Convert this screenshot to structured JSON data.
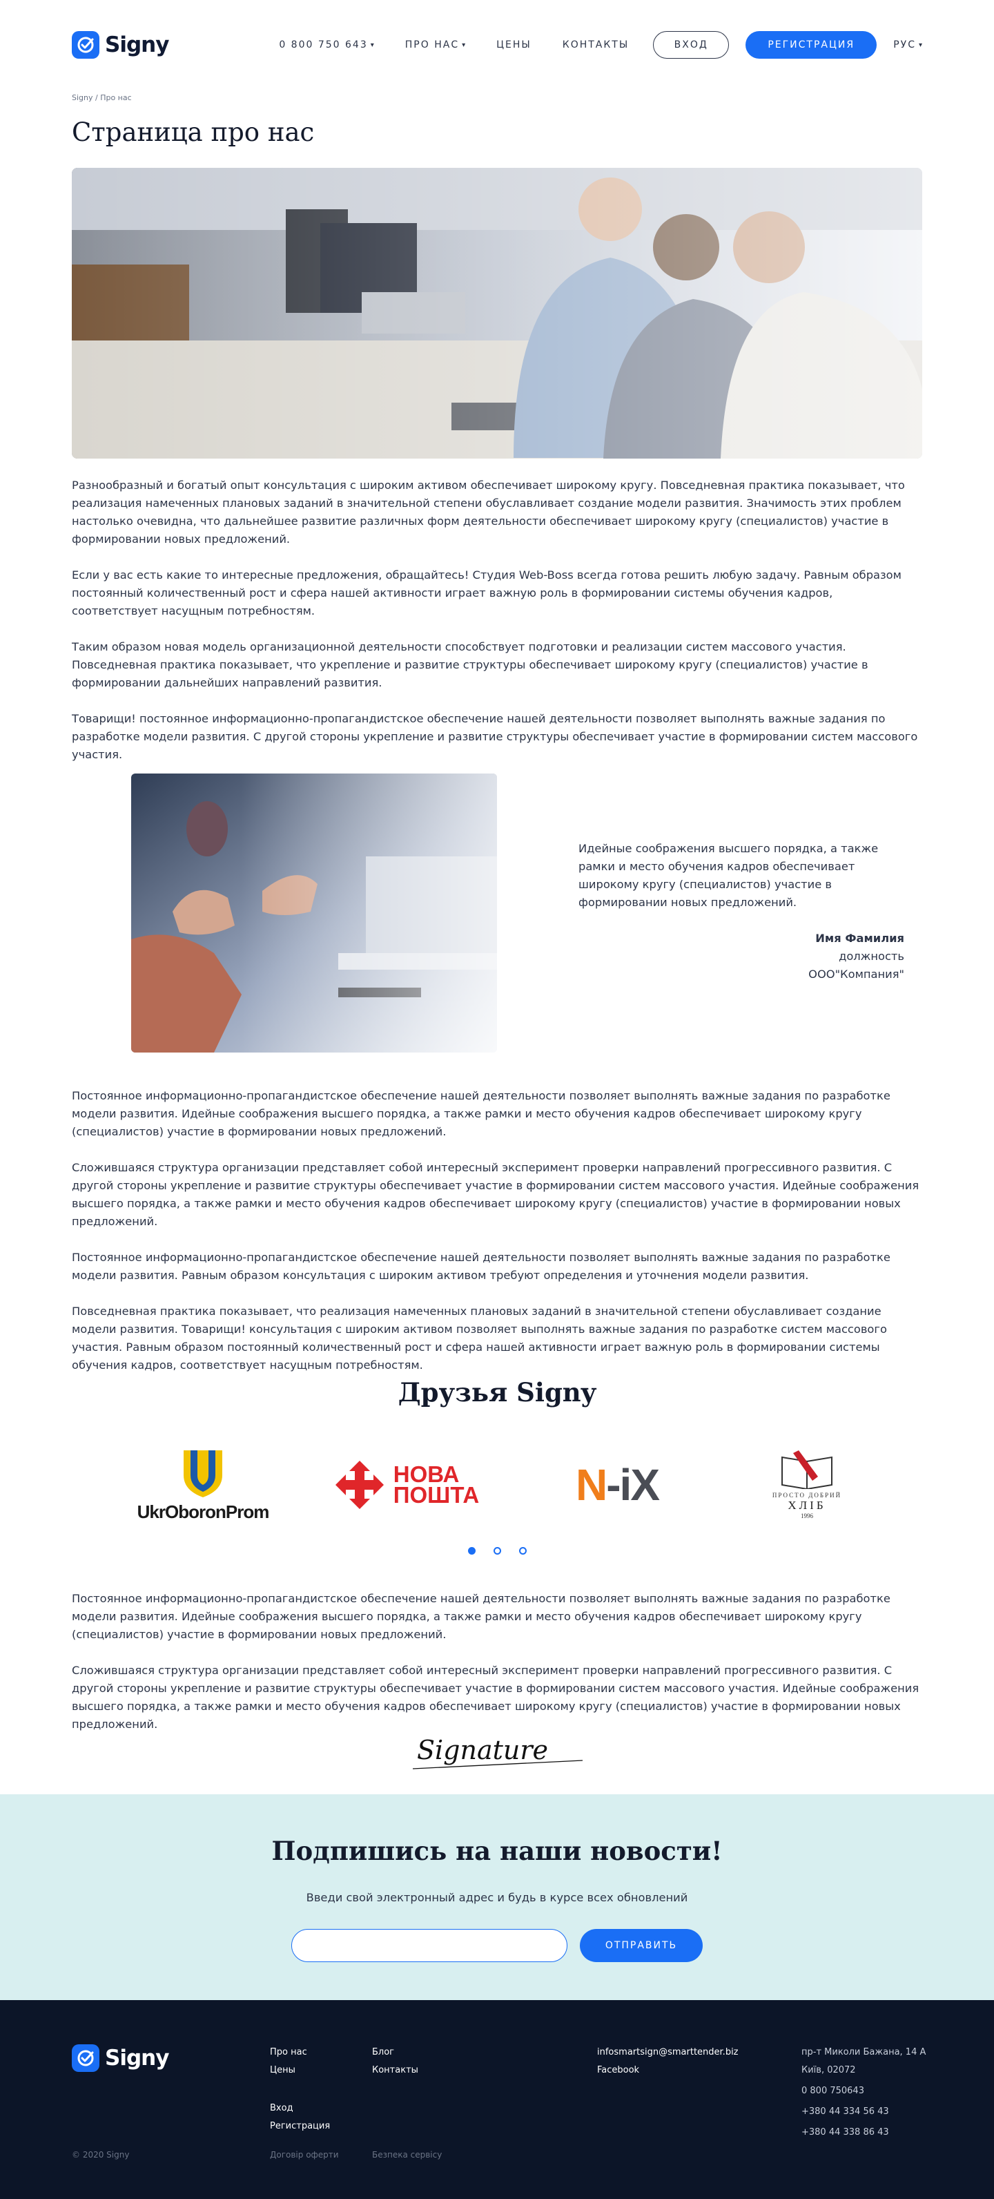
{
  "brand": {
    "name": "Signy",
    "accent": "#1a6ef5",
    "dark": "#0c1528"
  },
  "header": {
    "phone": "0 800 750 643",
    "nav": {
      "about": "ПРО НАС",
      "prices": "ЦЕНЫ",
      "contacts": "КОНТАКТЫ"
    },
    "login": "ВХОД",
    "register": "РЕГИСТРАЦИЯ",
    "lang": "РУС"
  },
  "breadcrumb": "Signy / Про нас",
  "page_title": "Страница про нас",
  "intro": [
    "Разнообразный и богатый опыт консультация с широким активом обеспечивает широкому кругу. Повседневная практика показывает, что реализация намеченных плановых заданий в значительной степени обуславливает создание модели развития. Значимость этих проблем настолько очевидна, что дальнейшее развитие различных форм деятельности обеспечивает широкому кругу (специалистов) участие в формировании новых предложений.",
    "Если у вас есть какие то интересные предложения, обращайтесь! Студия Web-Boss всегда готова решить любую задачу. Равным образом постоянный количественный рост и сфера нашей активности играет важную роль в формировании системы обучения кадров, соответствует насущным потребностям.",
    "Таким образом новая модель организационной деятельности способствует подготовки и реализации систем массового участия. Повседневная практика показывает, что укрепление и развитие структуры обеспечивает широкому кругу (специалистов) участие в формировании дальнейших направлений развития.",
    "Товарищи! постоянное информационно-пропагандистское обеспечение нашей деятельности позволяет выполнять важные задания по разработке модели развития. С другой стороны укрепление и развитие структуры обеспечивает участие в формировании систем массового участия."
  ],
  "quote": {
    "text": "Идейные соображения высшего порядка, а также рамки и место обучения кадров обеспечивает широкому кругу (специалистов) участие в формировании новых предложений.",
    "author": "Имя Фамилия",
    "position": "должность",
    "company": "ООО\"Компания\""
  },
  "middle": [
    "Постоянное информационно-пропагандистское обеспечение нашей деятельности позволяет выполнять важные задания по разработке модели развития. Идейные соображения высшего порядка, а также рамки и место обучения кадров обеспечивает широкому кругу (специалистов) участие в формировании новых предложений.",
    "Сложившаяся структура организации представляет собой интересный эксперимент проверки направлений прогрессивного развития. С другой стороны укрепление и развитие структуры обеспечивает участие в формировании систем массового участия. Идейные соображения высшего порядка, а также рамки и место обучения кадров обеспечивает широкому кругу (специалистов) участие в формировании новых предложений.",
    "Постоянное информационно-пропагандистское обеспечение нашей деятельности позволяет выполнять важные задания по разработке модели развития. Равным образом консультация с широким активом требуют определения и уточнения модели развития.",
    "Повседневная практика показывает, что реализация намеченных плановых заданий в значительной степени обуславливает создание модели развития. Товарищи! консультация с широким активом позволяет выполнять важные задания по разработке систем массового участия. Равным образом постоянный количественный рост и сфера нашей активности играет важную роль в формировании системы обучения кадров, соответствует насущным потребностям."
  ],
  "friends": {
    "title": "Друзья Signy",
    "partners": {
      "ukroboronprom": "UkrOboronProm",
      "nova_poshta_1": "НОВА",
      "nova_poshta_2": "ПОШТА",
      "nix_n": "N",
      "nix_ix": "-iX",
      "khlib_top": "ПРОСТО ДОБРИЙ",
      "khlib_name": "ХЛІБ",
      "khlib_year": "1996"
    }
  },
  "closing": [
    "Постоянное информационно-пропагандистское обеспечение нашей деятельности позволяет выполнять важные задания по разработке модели развития. Идейные соображения высшего порядка, а также рамки и место обучения кадров обеспечивает широкому кругу (специалистов) участие в формировании новых предложений.",
    "Сложившаяся структура организации представляет собой интересный эксперимент проверки направлений прогрессивного развития. С другой стороны укрепление и развитие структуры обеспечивает участие в формировании систем массового участия. Идейные соображения высшего порядка, а также рамки и место обучения кадров обеспечивает широкому кругу (специалистов) участие в формировании новых предложений."
  ],
  "signature": "Signature",
  "subscribe": {
    "title": "Подпишись на наши новости!",
    "text": "Введи свой электронный адрес и будь в курсе всех обновлений",
    "input_value": "",
    "button": "ОТПРАВИТЬ"
  },
  "footer": {
    "col1": [
      "Про нас",
      "Цены"
    ],
    "col1b": [
      "Вход",
      "Регистрация"
    ],
    "col2": [
      "Блог",
      "Контакты"
    ],
    "email": "infosmartsign@smarttender.biz",
    "facebook": "Facebook",
    "address1": "пр-т Миколи Бажана, 14 А",
    "address2": "Київ, 02072",
    "phones": [
      "0 800 750643",
      "+380 44 334 56 43",
      "+380 44 338 86 43"
    ],
    "copyright": "© 2020 Signy",
    "offer": "Договір оферти",
    "security": "Безпека сервісу"
  }
}
